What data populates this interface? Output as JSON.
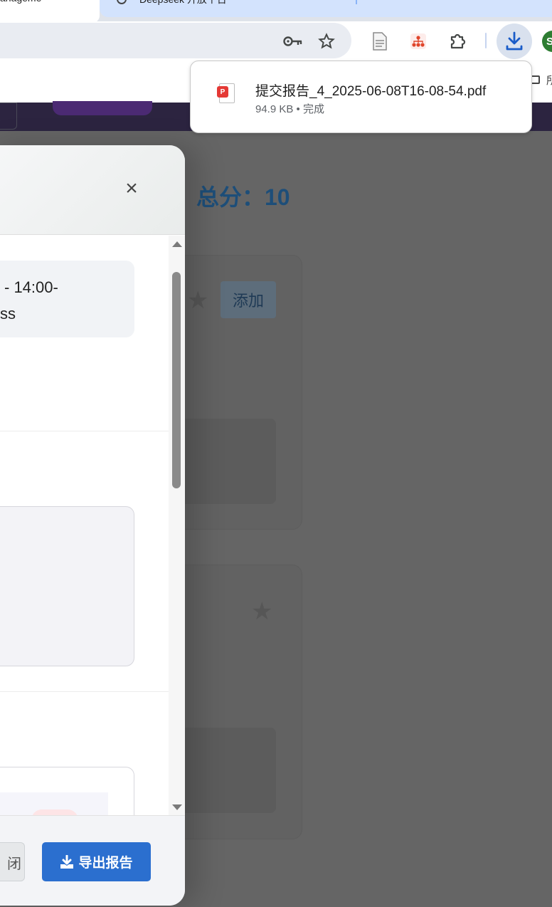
{
  "browser": {
    "active_tab_title": "anageme",
    "inactive_tab_title": "Deepseek 开放平台",
    "bookmark_label": "所",
    "profile_initial": "S"
  },
  "download": {
    "filename": "提交报告_4_2025-06-08T16-08-54.pdf",
    "size_status": "94.9 KB • 完成"
  },
  "page": {
    "total_score": "总分：10",
    "add_label": "添加",
    "star_glyph": "★"
  },
  "modal": {
    "close_glyph": "×",
    "info_line1": "- 14:00-",
    "info_line2": "ss",
    "close_button_label": "闭",
    "export_button_label": "导出报告"
  },
  "colors": {
    "accent": "#2b6fcf",
    "score_text": "#1d4e79",
    "dim_overlay": "#656565"
  }
}
